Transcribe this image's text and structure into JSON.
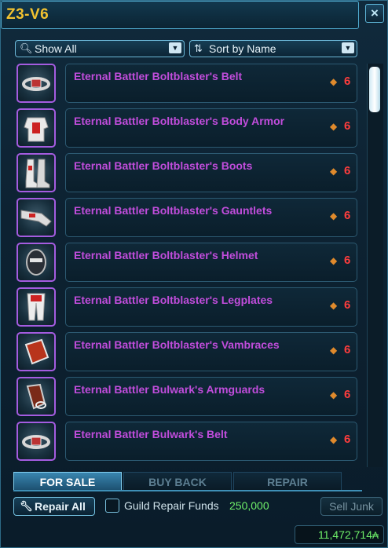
{
  "window": {
    "title": "Z3-V6",
    "close_icon": "×"
  },
  "filters": {
    "show": {
      "icon": "search-icon",
      "label": "Show All"
    },
    "sort": {
      "icon": "sort-icon",
      "label": "Sort by Name"
    }
  },
  "items": [
    {
      "name": "Eternal Battler Boltblaster's Belt",
      "price": "6",
      "icon": "belt-icon"
    },
    {
      "name": "Eternal Battler Boltblaster's Body Armor",
      "price": "6",
      "icon": "body-armor-icon"
    },
    {
      "name": "Eternal Battler Boltblaster's Boots",
      "price": "6",
      "icon": "boots-icon"
    },
    {
      "name": "Eternal Battler Boltblaster's Gauntlets",
      "price": "6",
      "icon": "gauntlets-icon"
    },
    {
      "name": "Eternal Battler Boltblaster's Helmet",
      "price": "6",
      "icon": "helmet-icon"
    },
    {
      "name": "Eternal Battler Boltblaster's Legplates",
      "price": "6",
      "icon": "legplates-icon"
    },
    {
      "name": "Eternal Battler Boltblaster's Vambraces",
      "price": "6",
      "icon": "vambraces-icon"
    },
    {
      "name": "Eternal Battler Bulwark's Armguards",
      "price": "6",
      "icon": "armguards-icon"
    },
    {
      "name": "Eternal Battler Bulwark's Belt",
      "price": "6",
      "icon": "belt-icon"
    }
  ],
  "tabs": [
    {
      "label": "FOR SALE",
      "active": true
    },
    {
      "label": "BUY BACK",
      "active": false
    },
    {
      "label": "REPAIR",
      "active": false
    }
  ],
  "footer": {
    "repair_all_label": "Repair All",
    "guild_repair_label": "Guild Repair Funds",
    "guild_repair_amount": "250,000",
    "sell_junk_label": "Sell Junk",
    "credits": "11,472,714"
  },
  "colors": {
    "title": "#f2c230",
    "item_name": "#c14ddc",
    "price": "#ff3d3d",
    "credits": "#6ff06a",
    "accent": "#4fa8cc"
  }
}
